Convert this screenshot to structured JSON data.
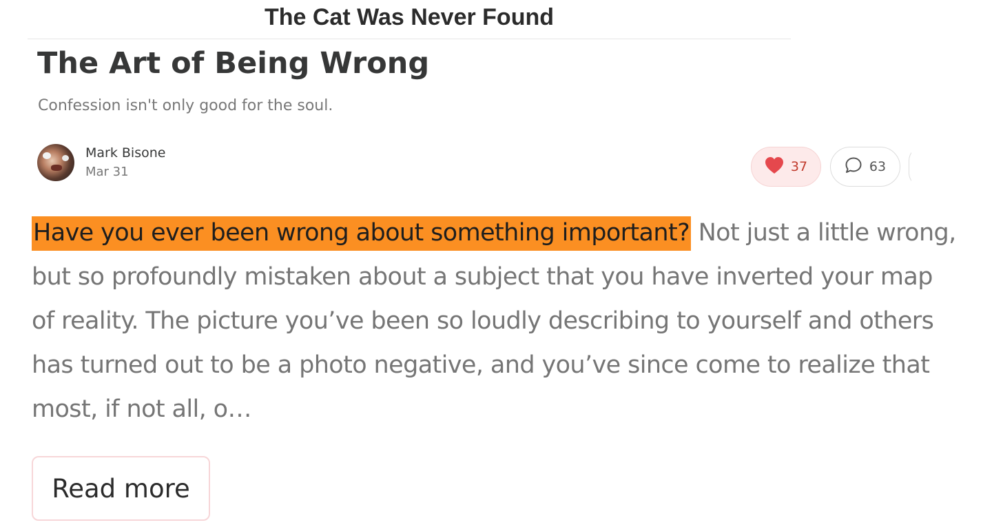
{
  "publication": {
    "name": "The Cat Was Never Found"
  },
  "post": {
    "title": "The Art of Being Wrong",
    "subtitle": "Confession isn't only good for the soul.",
    "author": {
      "name": "Mark Bisone",
      "date": "Mar 31"
    },
    "actions": {
      "likes": "37",
      "comments": "63"
    },
    "excerpt": {
      "highlighted": "Have you ever been wrong about something important?",
      "line1_rest": " Not just a little wrong,",
      "line2": "but so profoundly mistaken about a subject that you have inverted your map",
      "line3": "of reality. The picture you’ve been so loudly describing to yourself and others",
      "line4": "has turned out to be a photo negative, and you’ve since come to realize that",
      "line5": "most, if not all, o…"
    },
    "read_more_label": "Read more"
  },
  "colors": {
    "highlight": "#fb8f22",
    "like_bg": "#fdeaea",
    "heart": "#e5484d",
    "text_muted": "#757575"
  },
  "icons": {
    "like": "heart-icon",
    "comment": "comment-bubble-icon"
  }
}
